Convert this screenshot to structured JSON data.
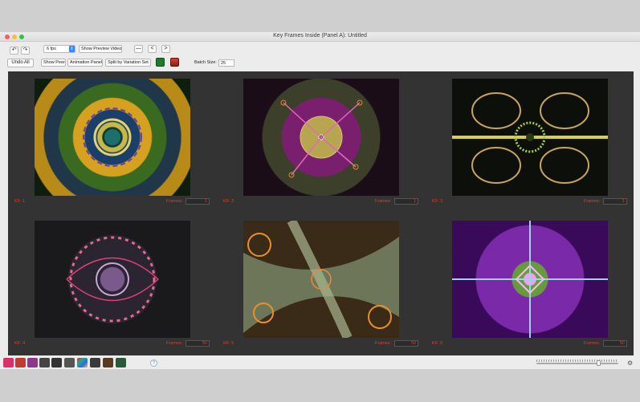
{
  "window": {
    "title": "Key Frames Inside (Panel A): Untitled"
  },
  "toolbar": {
    "fps_value": "6 fps",
    "show_preview_video": "Show Preview Video",
    "minus_label": "—",
    "prev_label": "<",
    "next_label": ">",
    "undo_all": "Undo All",
    "show_peer": "Show Peer",
    "animation_panel": "Animation Panel",
    "split_by_variation_set": "Split by Variation Set",
    "batch_size_label": "Batch Size:",
    "batch_size_value": "25"
  },
  "frames": [
    {
      "kf_label": "KF: 1",
      "frames_label": "Frames:",
      "frames_value": "1"
    },
    {
      "kf_label": "KF: 2",
      "frames_label": "Frames:",
      "frames_value": "1"
    },
    {
      "kf_label": "KF: 3",
      "frames_label": "Frames:",
      "frames_value": "1"
    },
    {
      "kf_label": "KF: 4",
      "frames_label": "Frames:",
      "frames_value": "50"
    },
    {
      "kf_label": "KF: 5",
      "frames_label": "Frames:",
      "frames_value": "50"
    },
    {
      "kf_label": "KF: 6",
      "frames_label": "Frames:",
      "frames_value": "50"
    }
  ],
  "statusbar": {
    "help_label": "?",
    "zoom_level": 0.75,
    "tools": [
      "home-icon",
      "grid-icon",
      "panels-icon",
      "eye-icon",
      "info-icon",
      "text-icon",
      "palette-icon",
      "star-icon",
      "star-badge-icon",
      "export-icon"
    ]
  },
  "colors": {
    "accent": "#3d86f5",
    "label_red": "#d84030",
    "panel_bg": "#333333"
  }
}
